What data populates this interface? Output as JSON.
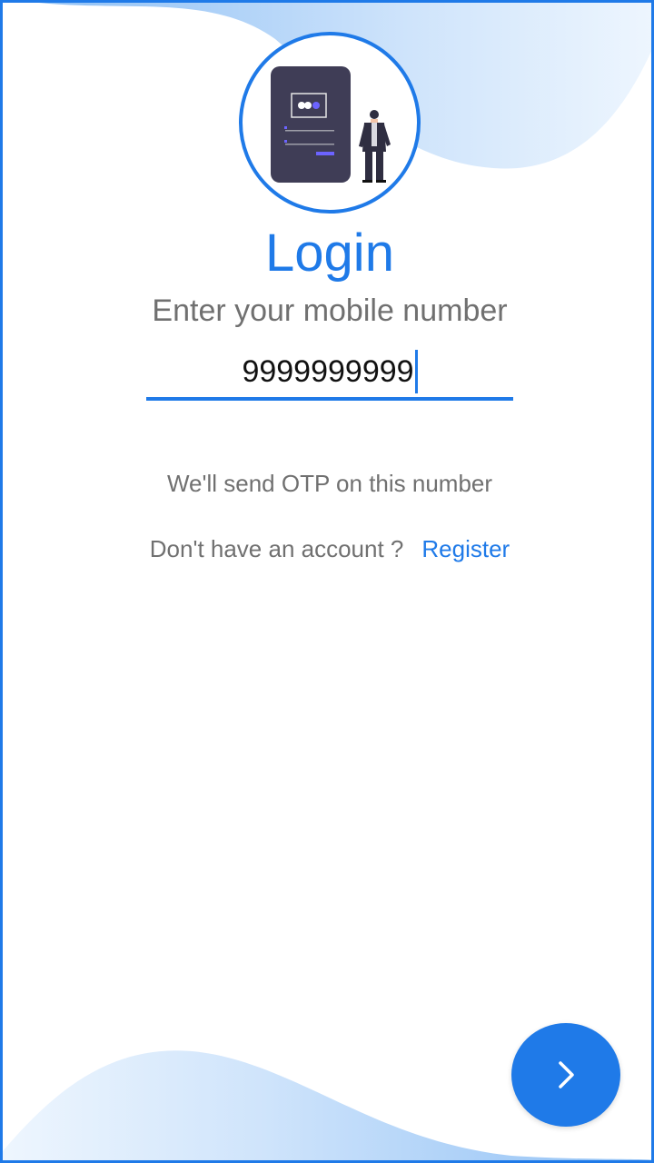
{
  "login": {
    "title": "Login",
    "subtitle": "Enter your mobile number",
    "phone_value": "9999999999",
    "otp_hint": "We'll send OTP on this number",
    "no_account_text": "Don't have an account ?",
    "register_label": "Register"
  },
  "icons": {
    "next": "chevron-right-icon",
    "illustration": "login-illustration"
  },
  "colors": {
    "accent": "#1f7ae8",
    "muted_text": "#707070",
    "wave_light": "#cfe4fb"
  }
}
